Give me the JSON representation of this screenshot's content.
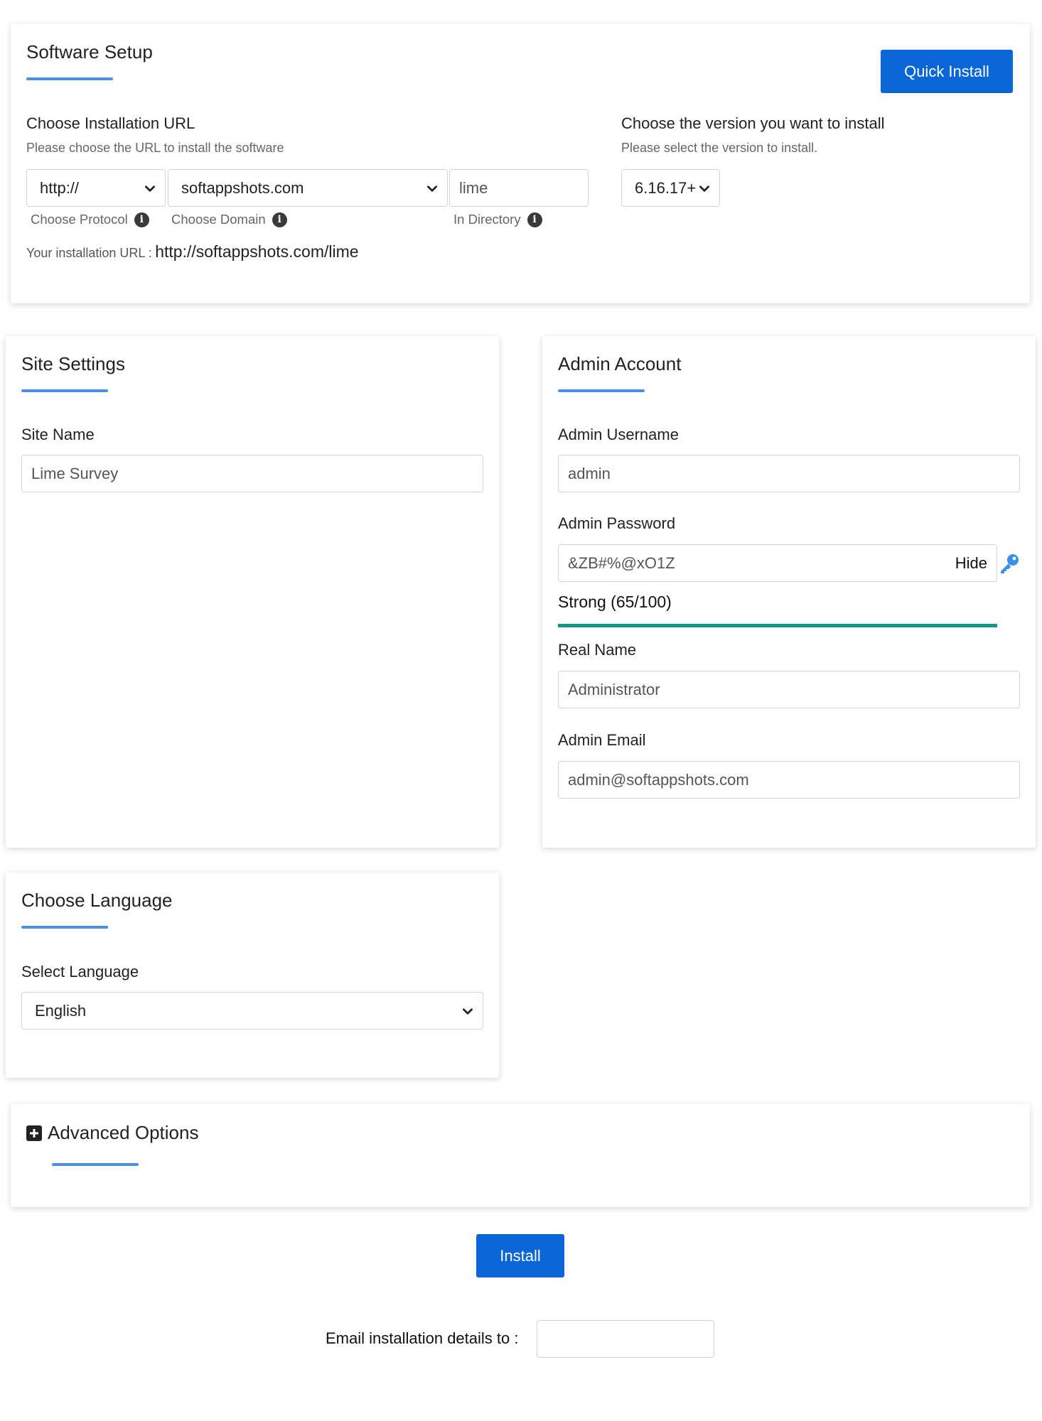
{
  "software_setup": {
    "title": "Software Setup",
    "quick_install_label": "Quick Install",
    "install_url": {
      "heading": "Choose Installation URL",
      "hint": "Please choose the URL to install the software",
      "protocol_value": "http://",
      "protocol_label": "Choose Protocol",
      "domain_value": "softappshots.com",
      "domain_label": "Choose Domain",
      "directory_value": "lime",
      "directory_label": "In Directory",
      "url_prefix": "Your installation URL :",
      "url_value": "http://softappshots.com/lime"
    },
    "version": {
      "heading": "Choose the version you want to install",
      "hint": "Please select the version to install.",
      "value": "6.16.17+"
    }
  },
  "site_settings": {
    "title": "Site Settings",
    "site_name_label": "Site Name",
    "site_name_value": "Lime Survey"
  },
  "admin_account": {
    "title": "Admin Account",
    "username_label": "Admin Username",
    "username_value": "admin",
    "password_label": "Admin Password",
    "password_value": "&ZB#%@xO1Z",
    "hide_label": "Hide",
    "strength_label": "Strong (65/100)",
    "strength_fraction": 0.65,
    "real_name_label": "Real Name",
    "real_name_value": "Administrator",
    "email_label": "Admin Email",
    "email_value": "admin@softappshots.com"
  },
  "language": {
    "title": "Choose Language",
    "select_label": "Select Language",
    "selected": "English"
  },
  "advanced": {
    "title": "Advanced Options"
  },
  "footer": {
    "install_label": "Install",
    "email_details_label": "Email installation details to :",
    "email_details_value": ""
  },
  "colors": {
    "accent_blue": "#0a66d6",
    "underline_blue": "#4a90e2",
    "strength_bar": "#119688",
    "key_icon": "#3b8fe6"
  }
}
